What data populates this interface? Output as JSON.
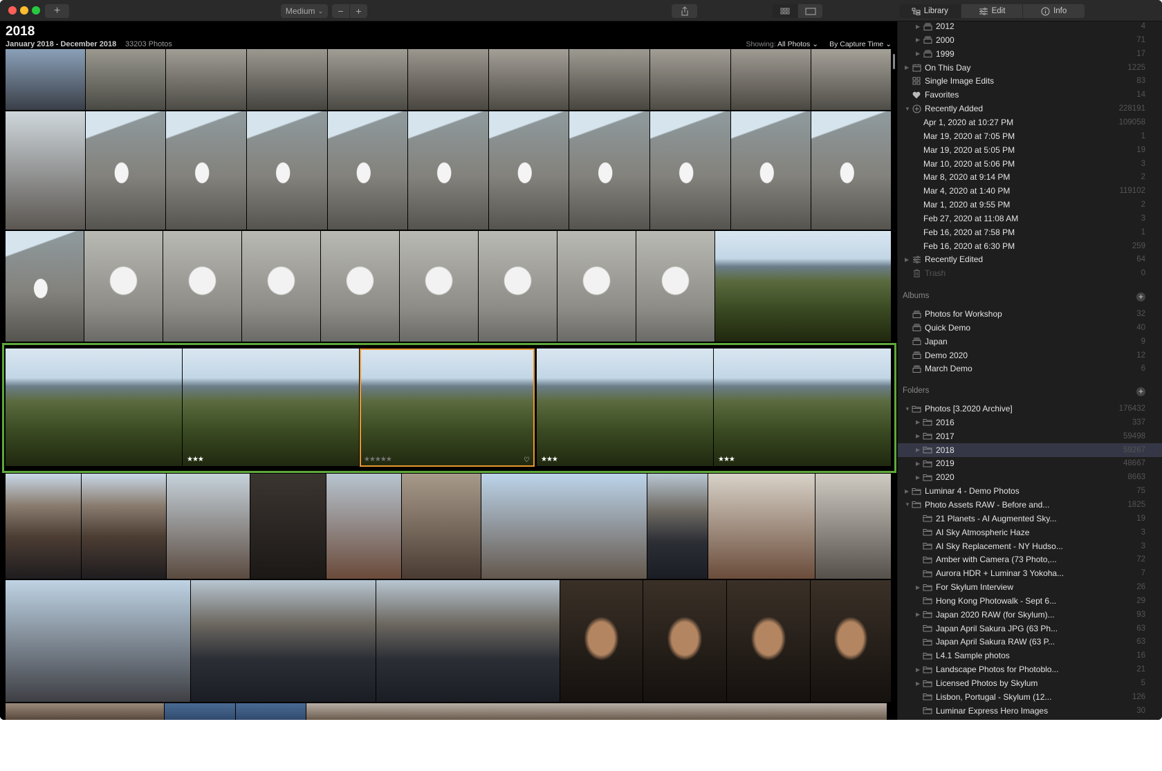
{
  "window": {
    "toolbar": {
      "add_label": "+",
      "zoom_preset": "Medium",
      "zoom_out": "−",
      "zoom_in": "+"
    },
    "sidebar_tabs": [
      {
        "label": "Library",
        "icon": "library-icon",
        "active": true
      },
      {
        "label": "Edit",
        "icon": "sliders-icon",
        "active": false
      },
      {
        "label": "Info",
        "icon": "info-icon",
        "active": false
      }
    ]
  },
  "gallery": {
    "title": "2018",
    "date_range": "January 2018 - December 2018",
    "photo_count": "33203 Photos",
    "showing_label": "Showing:",
    "showing_value": "All Photos ⌄",
    "sort_value": "By Capture Time ⌄",
    "selected_row_color": "#5fa83a",
    "selected_photo_color": "#e8962f",
    "selected_row": [
      {
        "stars": "",
        "selected": false
      },
      {
        "stars": "★★★",
        "selected": false
      },
      {
        "stars": "★★★★★",
        "selected": true,
        "dim": true,
        "favorite": "♡"
      },
      {
        "stars": "★★★",
        "selected": false
      },
      {
        "stars": "★★★",
        "selected": false
      }
    ]
  },
  "sidebar": {
    "top_items": [
      {
        "label": "2012",
        "count": "4",
        "level": 2,
        "tri": "▶",
        "icon": "album"
      },
      {
        "label": "2000",
        "count": "71",
        "level": 2,
        "tri": "▶",
        "icon": "album"
      },
      {
        "label": "1999",
        "count": "17",
        "level": 2,
        "tri": "▶",
        "icon": "album"
      },
      {
        "label": "On This Day",
        "count": "1225",
        "level": 1,
        "tri": "▶",
        "icon": "calendar"
      },
      {
        "label": "Single Image Edits",
        "count": "83",
        "level": 1,
        "tri": "",
        "icon": "grid"
      },
      {
        "label": "Favorites",
        "count": "14",
        "level": 1,
        "tri": "",
        "icon": "heart"
      },
      {
        "label": "Recently Added",
        "count": "228191",
        "level": 1,
        "tri": "▼",
        "icon": "plus-circle"
      },
      {
        "label": "Apr 1, 2020 at 10:27 PM",
        "count": "109058",
        "level": 3,
        "tri": "",
        "icon": ""
      },
      {
        "label": "Mar 19, 2020 at 7:05 PM",
        "count": "1",
        "level": 3,
        "tri": "",
        "icon": ""
      },
      {
        "label": "Mar 19, 2020 at 5:05 PM",
        "count": "19",
        "level": 3,
        "tri": "",
        "icon": ""
      },
      {
        "label": "Mar 10, 2020 at 5:06 PM",
        "count": "3",
        "level": 3,
        "tri": "",
        "icon": ""
      },
      {
        "label": "Mar 8, 2020 at 9:14 PM",
        "count": "2",
        "level": 3,
        "tri": "",
        "icon": ""
      },
      {
        "label": "Mar 4, 2020 at 1:40 PM",
        "count": "119102",
        "level": 3,
        "tri": "",
        "icon": ""
      },
      {
        "label": "Mar 1, 2020 at 9:55 PM",
        "count": "2",
        "level": 3,
        "tri": "",
        "icon": ""
      },
      {
        "label": "Feb 27, 2020 at 11:08 AM",
        "count": "3",
        "level": 3,
        "tri": "",
        "icon": ""
      },
      {
        "label": "Feb 16, 2020 at 7:58 PM",
        "count": "1",
        "level": 3,
        "tri": "",
        "icon": ""
      },
      {
        "label": "Feb 16, 2020 at 6:30 PM",
        "count": "259",
        "level": 3,
        "tri": "",
        "icon": ""
      },
      {
        "label": "Recently Edited",
        "count": "64",
        "level": 1,
        "tri": "▶",
        "icon": "sliders"
      },
      {
        "label": "Trash",
        "count": "0",
        "level": 1,
        "tri": "",
        "icon": "trash",
        "dim": true
      }
    ],
    "albums_header": "Albums",
    "albums": [
      {
        "label": "Photos for Workshop",
        "count": "32"
      },
      {
        "label": "Quick Demo",
        "count": "40"
      },
      {
        "label": "Japan",
        "count": "9"
      },
      {
        "label": "Demo 2020",
        "count": "12"
      },
      {
        "label": "March Demo",
        "count": "6"
      }
    ],
    "folders_header": "Folders",
    "folders": [
      {
        "label": "Photos [3.2020 Archive]",
        "count": "176432",
        "level": 1,
        "tri": "▼",
        "open": true
      },
      {
        "label": "2016",
        "count": "337",
        "level": 2,
        "tri": "▶"
      },
      {
        "label": "2017",
        "count": "59498",
        "level": 2,
        "tri": "▶"
      },
      {
        "label": "2018",
        "count": "59267",
        "level": 2,
        "tri": "▶",
        "selected": true
      },
      {
        "label": "2019",
        "count": "48667",
        "level": 2,
        "tri": "▶"
      },
      {
        "label": "2020",
        "count": "8663",
        "level": 2,
        "tri": "▶"
      },
      {
        "label": "Luminar 4 - Demo Photos",
        "count": "75",
        "level": 1,
        "tri": "▶"
      },
      {
        "label": "Photo Assets RAW - Before and...",
        "count": "1825",
        "level": 1,
        "tri": "▼",
        "open": true
      },
      {
        "label": "21 Planets - AI Augmented Sky...",
        "count": "19",
        "level": 2,
        "tri": ""
      },
      {
        "label": "AI Sky Atmospheric Haze",
        "count": "3",
        "level": 2,
        "tri": ""
      },
      {
        "label": "AI Sky Replacement - NY Hudso...",
        "count": "3",
        "level": 2,
        "tri": ""
      },
      {
        "label": "Amber with Camera (73 Photo,...",
        "count": "72",
        "level": 2,
        "tri": ""
      },
      {
        "label": "Aurora HDR + Luminar 3 Yokoha...",
        "count": "7",
        "level": 2,
        "tri": ""
      },
      {
        "label": "For Skylum Interview",
        "count": "26",
        "level": 2,
        "tri": "▶"
      },
      {
        "label": "Hong Kong Photowalk - Sept 6...",
        "count": "29",
        "level": 2,
        "tri": ""
      },
      {
        "label": "Japan 2020 RAW (for Skylum)...",
        "count": "93",
        "level": 2,
        "tri": "▶"
      },
      {
        "label": "Japan April Sakura JPG (63 Ph...",
        "count": "63",
        "level": 2,
        "tri": ""
      },
      {
        "label": "Japan April Sakura RAW (63 P...",
        "count": "63",
        "level": 2,
        "tri": ""
      },
      {
        "label": "L4.1 Sample photos",
        "count": "16",
        "level": 2,
        "tri": ""
      },
      {
        "label": "Landscape Photos for Photoblo...",
        "count": "21",
        "level": 2,
        "tri": "▶"
      },
      {
        "label": "Licensed Photos by Skylum",
        "count": "5",
        "level": 2,
        "tri": "▶"
      },
      {
        "label": "Lisbon, Portugal - Skylum (12...",
        "count": "126",
        "level": 2,
        "tri": ""
      },
      {
        "label": "Luminar Express Hero Images",
        "count": "30",
        "level": 2,
        "tri": ""
      }
    ]
  }
}
